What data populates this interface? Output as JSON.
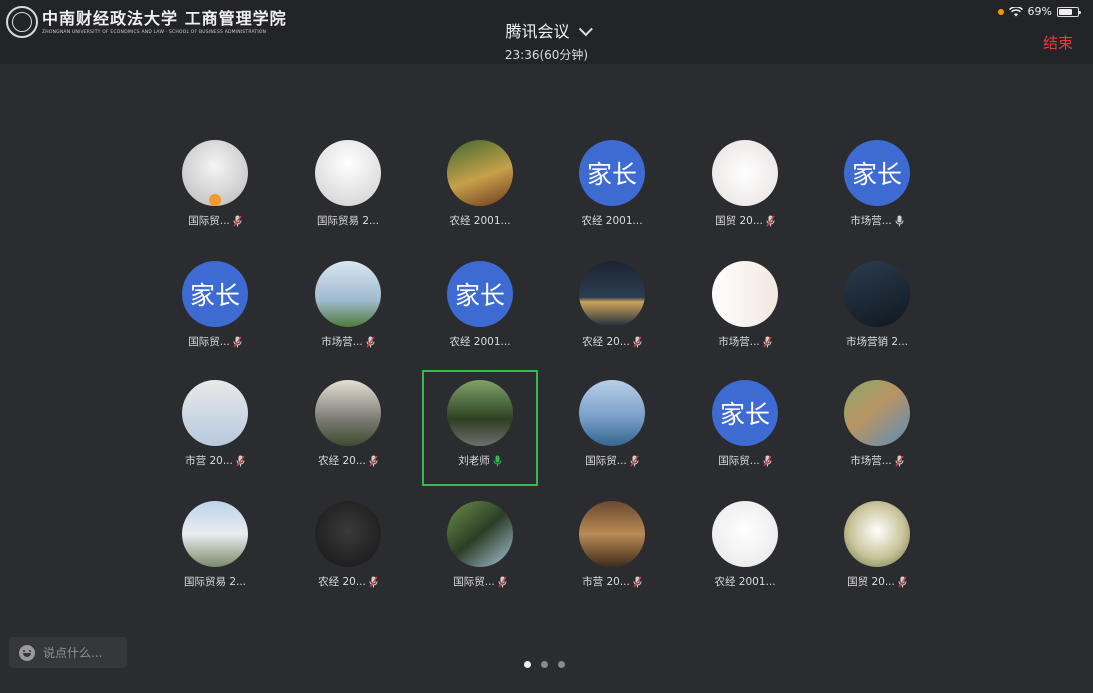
{
  "header": {
    "logo_text": "中南财经政法大学 工商管理学院",
    "logo_subtext": "ZHONGNAN UNIVERSITY OF ECONOMICS AND LAW · SCHOOL OF BUSINESS ADMINISTRATION",
    "meeting_title": "腾讯会议",
    "meeting_time": "23:36(60分钟)",
    "end_label": "结束",
    "battery": "69%"
  },
  "participants": [
    {
      "label": "国际贸...",
      "avatar": "photo",
      "mic": "muted",
      "badge": true
    },
    {
      "label": "国际贸易 2...",
      "avatar": "photo",
      "mic": "none"
    },
    {
      "label": "农经 2001...",
      "avatar": "photo",
      "mic": "none"
    },
    {
      "label": "农经 2001...",
      "avatar": "家长",
      "mic": "none"
    },
    {
      "label": "国贸 20...",
      "avatar": "photo",
      "mic": "muted"
    },
    {
      "label": "市场营...",
      "avatar": "家长",
      "mic": "on"
    },
    {
      "label": "国际贸...",
      "avatar": "家长",
      "mic": "muted"
    },
    {
      "label": "市场营...",
      "avatar": "photo",
      "mic": "muted"
    },
    {
      "label": "农经 2001...",
      "avatar": "家长",
      "mic": "none"
    },
    {
      "label": "农经 20...",
      "avatar": "photo",
      "mic": "muted"
    },
    {
      "label": "市场营...",
      "avatar": "photo",
      "mic": "muted"
    },
    {
      "label": "市场营销 2...",
      "avatar": "photo",
      "mic": "none"
    },
    {
      "label": "市营 20...",
      "avatar": "photo",
      "mic": "muted"
    },
    {
      "label": "农经 20...",
      "avatar": "photo",
      "mic": "muted"
    },
    {
      "label": "刘老师",
      "avatar": "photo",
      "mic": "active",
      "active": true
    },
    {
      "label": "国际贸...",
      "avatar": "photo",
      "mic": "muted"
    },
    {
      "label": "国际贸...",
      "avatar": "家长",
      "mic": "muted"
    },
    {
      "label": "市场营...",
      "avatar": "photo",
      "mic": "muted"
    },
    {
      "label": "国际贸易 2...",
      "avatar": "photo",
      "mic": "none"
    },
    {
      "label": "农经 20...",
      "avatar": "photo",
      "mic": "muted"
    },
    {
      "label": "国际贸...",
      "avatar": "photo",
      "mic": "muted"
    },
    {
      "label": "市营 20...",
      "avatar": "photo",
      "mic": "muted"
    },
    {
      "label": "农经 2001...",
      "avatar": "photo",
      "mic": "none"
    },
    {
      "label": "国贸 20...",
      "avatar": "photo",
      "mic": "muted"
    }
  ],
  "chat": {
    "placeholder": "说点什么..."
  },
  "pager": {
    "pages": 3,
    "current": 0
  },
  "colors": {
    "accent_green": "#35b84a",
    "end_red": "#e83a3a",
    "parent_avatar_blue": "#3d6bd1"
  }
}
